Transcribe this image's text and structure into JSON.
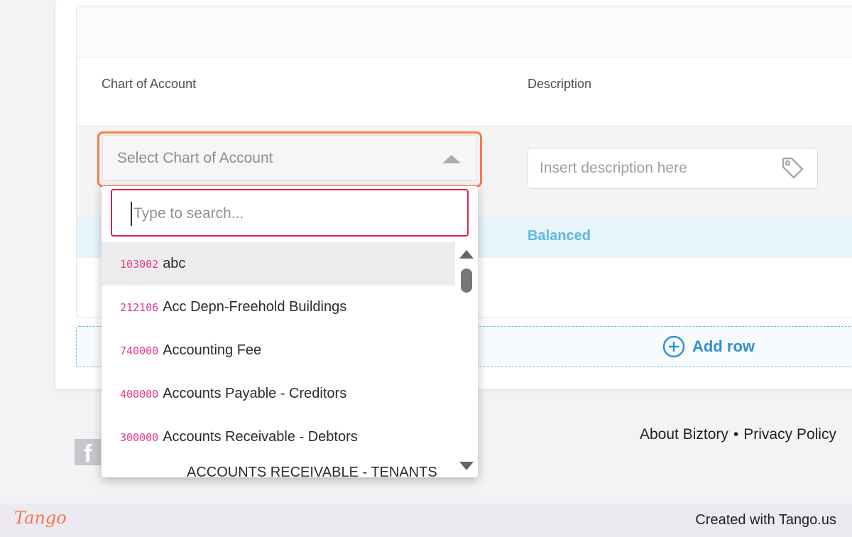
{
  "table": {
    "columns": {
      "chart_of_account": "Chart of Account",
      "description": "Description"
    },
    "status": "Balanced"
  },
  "select": {
    "placeholder": "Select Chart of Account",
    "state": "open"
  },
  "description_input": {
    "placeholder": "Insert description here",
    "value": ""
  },
  "dropdown": {
    "search_placeholder": "Type to search...",
    "options": [
      {
        "code": "103002",
        "name": "abc"
      },
      {
        "code": "212106",
        "name": "Acc Depn-Freehold Buildings"
      },
      {
        "code": "740000",
        "name": "Accounting Fee"
      },
      {
        "code": "400000",
        "name": "Accounts Payable - Creditors"
      },
      {
        "code": "300000",
        "name": "Accounts Receivable - Debtors"
      },
      {
        "code": "",
        "name": "ACCOUNTS RECEIVABLE - TENANTS"
      }
    ]
  },
  "add_row_label": "Add row",
  "footer": {
    "about": "About Biztory",
    "separator": "•",
    "privacy": "Privacy Policy"
  },
  "tango": {
    "logo": "Tango",
    "credit": "Created with Tango.us"
  },
  "colors": {
    "accent_orange": "#ff7a45",
    "search_border": "#d9224a",
    "code_pink": "#e8388a",
    "link_blue": "#2d8fd0",
    "balanced": "#5bb8e0"
  },
  "icons": {
    "tag": "tag-icon",
    "add": "plus-circle-icon",
    "facebook": "facebook-icon"
  }
}
